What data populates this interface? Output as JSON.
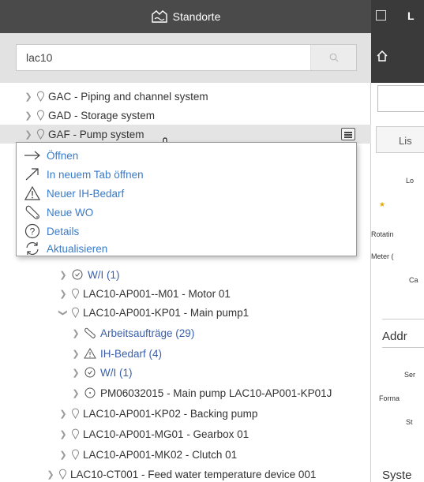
{
  "header": {
    "title": "Standorte"
  },
  "search": {
    "value": "lac10"
  },
  "tree": [
    {
      "label": "GAC - Piping and channel system"
    },
    {
      "label": "GAD - Storage system"
    },
    {
      "label": "GAF - Pump system"
    },
    {
      "label": "W/I (1)"
    },
    {
      "label": "LAC10-AP001--M01 - Motor 01"
    },
    {
      "label": "LAC10-AP001-KP01 - Main pump1"
    },
    {
      "label": "Arbeitsaufträge (29)"
    },
    {
      "label": "IH-Bedarf (4)"
    },
    {
      "label": "W/I (1)"
    },
    {
      "label": "PM06032015 - Main pump LAC10-AP001-KP01J"
    },
    {
      "label": "LAC10-AP001-KP02 - Backing pump"
    },
    {
      "label": "LAC10-AP001-MG01 - Gearbox 01"
    },
    {
      "label": "LAC10-AP001-MK02 - Clutch 01"
    },
    {
      "label": "LAC10-CT001 - Feed water temperature device 001"
    }
  ],
  "context_menu": [
    {
      "label": "Öffnen"
    },
    {
      "label": "In neuem Tab öffnen"
    },
    {
      "label": "Neuer IH-Bedarf"
    },
    {
      "label": "Neue WO"
    },
    {
      "label": "Details"
    },
    {
      "label": "Aktualisieren"
    }
  ],
  "right_panel": {
    "title_initial": "L",
    "tab_label": "Lis",
    "labels": [
      "Lo",
      "Rotatin",
      "Meter (",
      "Ca",
      "Ser",
      "Forma",
      "St"
    ],
    "section_addr": "Addr",
    "section_syst": "Syste"
  }
}
